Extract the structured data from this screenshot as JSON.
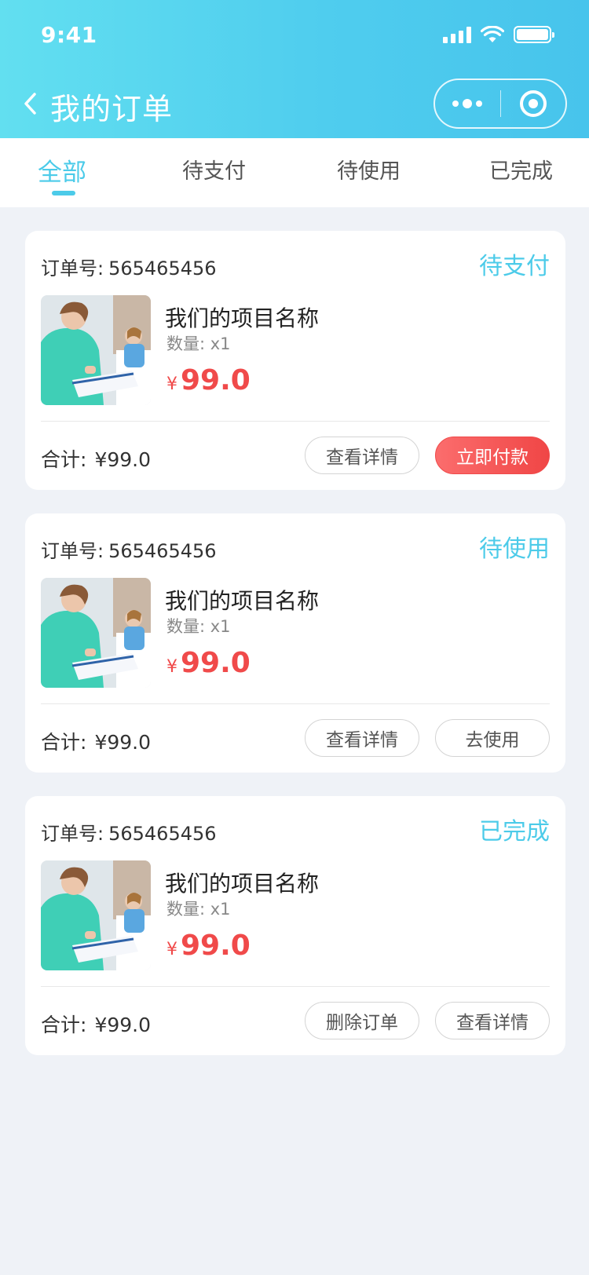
{
  "status_bar": {
    "time": "9:41",
    "icons": [
      "signal-icon",
      "wifi-icon",
      "battery-icon"
    ]
  },
  "nav": {
    "back_icon": "chevron-left-icon",
    "title": "我的订单",
    "capsule_icons": [
      "more-dots-icon",
      "target-icon"
    ]
  },
  "tabs": [
    {
      "label": "全部",
      "active": true
    },
    {
      "label": "待支付",
      "active": false
    },
    {
      "label": "待使用",
      "active": false
    },
    {
      "label": "已完成",
      "active": false
    }
  ],
  "colors": {
    "accent": "#4ccbe9",
    "price": "#f04a4a",
    "primary_button": "#f04a4a",
    "background": "#eff2f7"
  },
  "orders": [
    {
      "order_label": "订单号:",
      "order_no": "565465456",
      "status": "待支付",
      "item_name": "我们的项目名称",
      "qty": "数量: x1",
      "currency": "¥",
      "price": "99.0",
      "total_label": "合计:",
      "total": "¥99.0",
      "buttons": [
        "查看详情",
        "立即付款"
      ]
    },
    {
      "order_label": "订单号:",
      "order_no": "565465456",
      "status": "待使用",
      "item_name": "我们的项目名称",
      "qty": "数量: x1",
      "currency": "¥",
      "price": "99.0",
      "total_label": "合计:",
      "total": "¥99.0",
      "buttons": [
        "查看详情",
        "去使用"
      ]
    },
    {
      "order_label": "订单号:",
      "order_no": "565465456",
      "status": "已完成",
      "item_name": "我们的项目名称",
      "qty": "数量: x1",
      "currency": "¥",
      "price": "99.0",
      "total_label": "合计:",
      "total": "¥99.0",
      "buttons": [
        "删除订单",
        "查看详情"
      ]
    }
  ]
}
